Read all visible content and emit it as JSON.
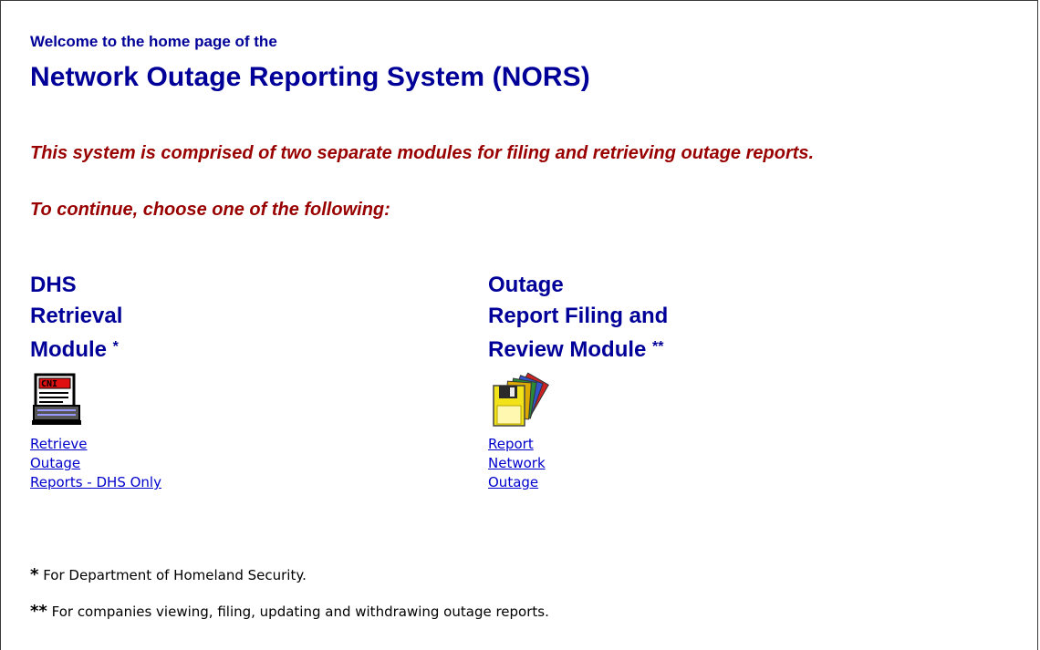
{
  "header": {
    "welcome": "Welcome to the home page of the",
    "title": "Network Outage Reporting System (NORS)"
  },
  "intro": {
    "description": "This system is comprised of two separate modules for filing and retrieving outage reports.",
    "prompt": "To continue, choose one of the following:"
  },
  "modules": [
    {
      "title_lines": [
        "DHS",
        "Retrieval",
        "Module"
      ],
      "mark": "*",
      "icon": "cni-document-icon",
      "link_lines": [
        "Retrieve",
        "Outage",
        "Reports - DHS Only"
      ]
    },
    {
      "title_lines": [
        "Outage",
        "Report Filing and",
        "Review Module"
      ],
      "mark": "**",
      "icon": "floppy-disk-icon",
      "link_lines": [
        "Report",
        "Network",
        "Outage"
      ]
    }
  ],
  "footnotes": [
    {
      "mark": "*",
      "text": "For Department of Homeland Security."
    },
    {
      "mark": "**",
      "text": "For companies viewing, filing, updating and withdrawing outage reports."
    }
  ]
}
